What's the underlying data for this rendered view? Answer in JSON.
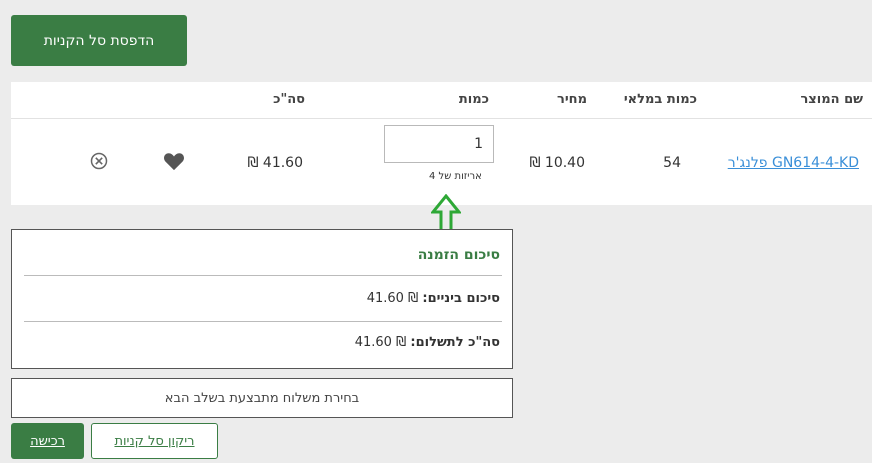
{
  "toolbar": {
    "print_label": "הדפסת סל הקניות"
  },
  "table": {
    "headers": {
      "product_name": "שם המוצר",
      "stock_qty": "כמות במלאי",
      "price": "מחיר",
      "quantity": "כמות",
      "total": "סה\"כ"
    },
    "row": {
      "product_name": "פלנג'ר GN614-4-KD",
      "stock_qty": "54",
      "price": "₪ 10.40",
      "quantity": "1",
      "pack_note": "אריזות של 4",
      "total": "₪ 41.60"
    }
  },
  "summary": {
    "title": "סיכום הזמנה",
    "subtotal_label": "סיכום ביניים:",
    "subtotal_value": "₪ 41.60",
    "total_label": "סה\"כ לתשלום:",
    "total_value": "₪ 41.60"
  },
  "shipping": {
    "note": "בחירת משלוח מתבצעת בשלב הבא"
  },
  "actions": {
    "clear_label": "ריקון סל קניות",
    "buy_label": "רכישה"
  },
  "colors": {
    "brand_green": "#3a7d44",
    "link_blue": "#3a8fd8",
    "arrow_green": "#2ea836"
  },
  "icons": {
    "wishlist": "heart-icon",
    "remove": "close-circle-icon",
    "pointer": "arrow-up-icon"
  }
}
